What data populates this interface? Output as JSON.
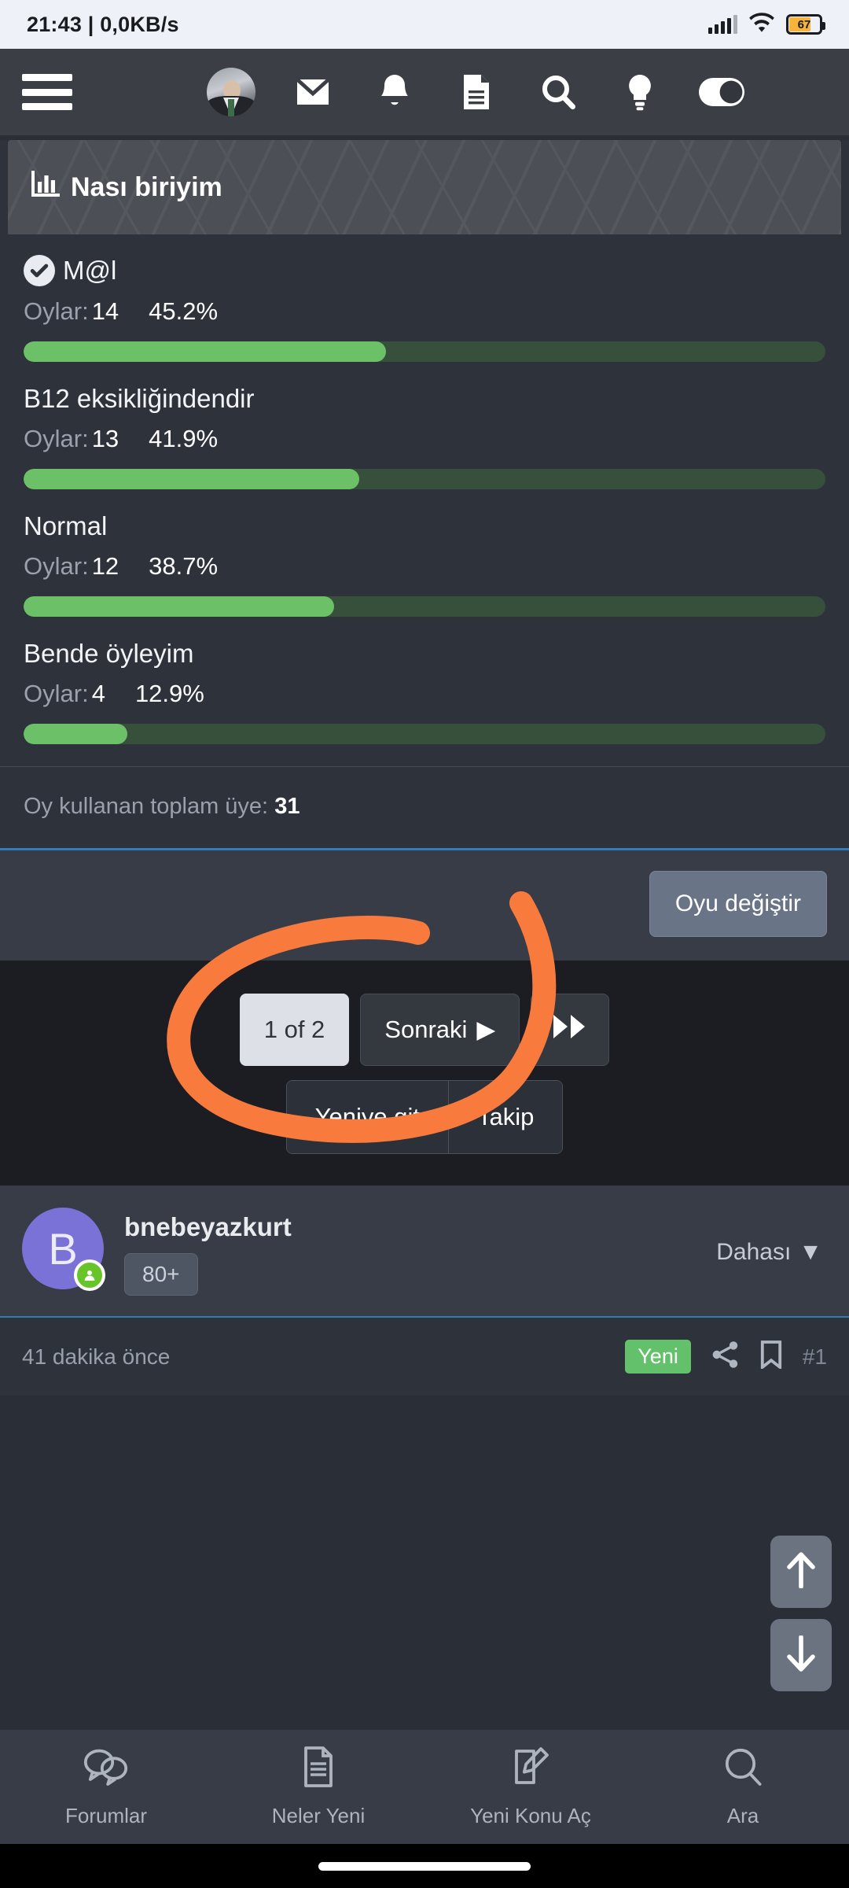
{
  "status_bar": {
    "clock": "21:43 | 0,0KB/s",
    "battery_level": "67",
    "signal_icon": "signal-bars-icon",
    "wifi_icon": "wifi-icon",
    "battery_icon": "battery-icon"
  },
  "top_nav": {
    "menu_icon": "hamburger-menu-icon",
    "avatar_icon": "user-avatar-photo",
    "items": [
      {
        "icon": "envelope-icon",
        "name": "inbox"
      },
      {
        "icon": "bell-icon",
        "name": "alerts"
      },
      {
        "icon": "document-icon",
        "name": "threads"
      },
      {
        "icon": "search-icon",
        "name": "search"
      },
      {
        "icon": "lightbulb-icon",
        "name": "highlights"
      },
      {
        "icon": "toggle-switch-icon",
        "name": "dark-mode-toggle"
      }
    ]
  },
  "poll": {
    "icon": "poll-chart-icon",
    "title": "Nası biriyim",
    "options": [
      {
        "label": "M@l",
        "voted": true,
        "votes_label": "Oylar:",
        "votes": "14",
        "percent_label": "45.2%",
        "percent": 45.2
      },
      {
        "label": "B12 eksikliğindendir",
        "voted": false,
        "votes_label": "Oylar:",
        "votes": "13",
        "percent_label": "41.9%",
        "percent": 41.9
      },
      {
        "label": "Normal",
        "voted": false,
        "votes_label": "Oylar:",
        "votes": "12",
        "percent_label": "38.7%",
        "percent": 38.7
      },
      {
        "label": "Bende öyleyim",
        "voted": false,
        "votes_label": "Oylar:",
        "votes": "4",
        "percent_label": "12.9%",
        "percent": 12.9
      }
    ],
    "total_label": "Oy kullanan toplam üye:",
    "total_value": "31",
    "change_vote_label": "Oyu değiştir",
    "bar_fill_color": "#6cc068",
    "bar_track_color": "#36503c"
  },
  "pagination": {
    "current_page_label": "1 of 2",
    "next_label": "Sonraki",
    "next_arrow": "▶",
    "last_icon": "fast-forward-icon",
    "go_new_label": "Yeniye git",
    "follow_label": "Takip"
  },
  "post": {
    "avatar_initial": "B",
    "username": "bnebeyazkurt",
    "post_count_badge": "80+",
    "more_label": "Dahası",
    "more_caret": "▼",
    "time_ago": "41 dakika önce",
    "new_badge": "Yeni",
    "share_icon": "share-icon",
    "bookmark_icon": "bookmark-icon",
    "post_number": "#1",
    "online_icon": "online-status-icon"
  },
  "floating": {
    "scroll_up_icon": "arrow-up-icon",
    "scroll_down_icon": "arrow-down-icon"
  },
  "bottom_nav": [
    {
      "label": "Forumlar",
      "icon": "forums-bubbles-icon"
    },
    {
      "label": "Neler Yeni",
      "icon": "whats-new-document-icon"
    },
    {
      "label": "Yeni Konu Aç",
      "icon": "compose-pencil-icon"
    },
    {
      "label": "Ara",
      "icon": "search-icon"
    }
  ],
  "annotation": {
    "type": "hand-drawn-circle",
    "color": "#f97a3d",
    "target": "Oy kullanan toplam üye: 31"
  },
  "chart_data": {
    "type": "bar",
    "title": "Nası biriyim",
    "categories": [
      "M@l",
      "B12 eksikliğindendir",
      "Normal",
      "Bende öyleyim"
    ],
    "values": [
      14,
      13,
      12,
      4
    ],
    "percentages": [
      45.2,
      41.9,
      38.7,
      12.9
    ],
    "xlabel": "",
    "ylabel": "Oylar",
    "ylim": [
      0,
      31
    ],
    "total_voters": 31,
    "legend": "none",
    "grid": false
  }
}
